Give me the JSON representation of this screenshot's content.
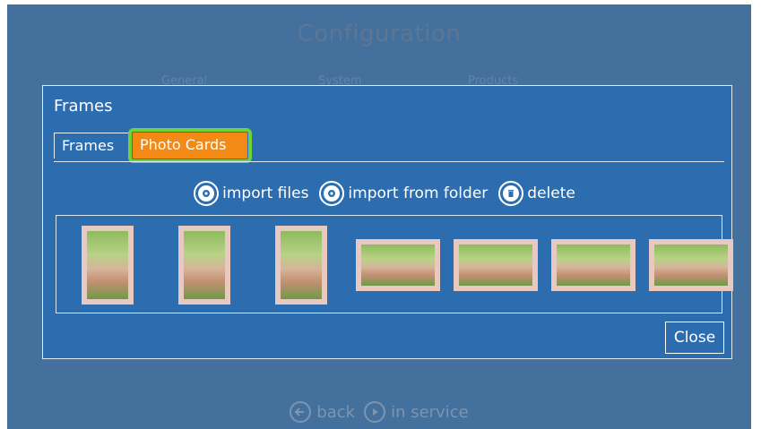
{
  "app": {
    "title": "Configuration",
    "tabs": [
      "General",
      "System",
      "Products"
    ]
  },
  "modal": {
    "title": "Frames",
    "tabs": [
      {
        "label": "Frames",
        "active": false
      },
      {
        "label": "Photo Cards",
        "active": true
      }
    ],
    "actions": [
      {
        "label": "import files",
        "icon": "gear-icon"
      },
      {
        "label": "import from folder",
        "icon": "gear-icon"
      },
      {
        "label": "delete",
        "icon": "trash-icon"
      }
    ],
    "thumbnails": [
      {
        "orientation": "portrait"
      },
      {
        "orientation": "portrait"
      },
      {
        "orientation": "portrait"
      },
      {
        "orientation": "landscape"
      },
      {
        "orientation": "landscape"
      },
      {
        "orientation": "landscape"
      },
      {
        "orientation": "landscape"
      }
    ],
    "close_label": "Close"
  },
  "bottom_nav": {
    "back_label": "back",
    "in_service_label": "in service"
  },
  "colors": {
    "background": "#44709e",
    "modal": "#2c6db0",
    "active_tab": "#f28a15",
    "highlight": "#6fd23a"
  }
}
